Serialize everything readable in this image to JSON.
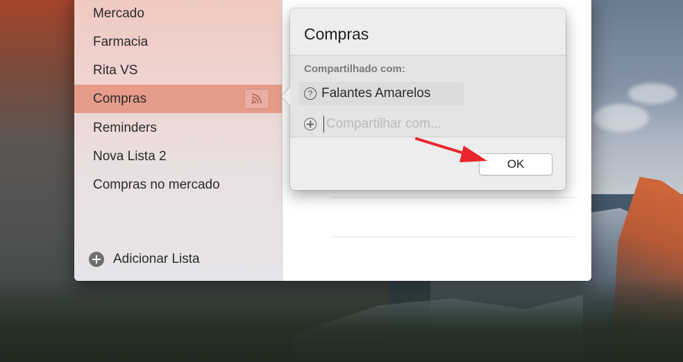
{
  "sidebar": {
    "items": [
      {
        "label": "Mercado"
      },
      {
        "label": "Farmacia"
      },
      {
        "label": "Rita VS"
      },
      {
        "label": "Compras",
        "selected": true,
        "shared_icon": "broadcast-share-icon"
      },
      {
        "label": "Reminders"
      },
      {
        "label": "Nova Lista 2"
      },
      {
        "label": "Compras no mercado"
      }
    ],
    "add_list_label": "Adicionar Lista",
    "add_list_icon": "plus-circle-icon"
  },
  "popover": {
    "title": "Compras",
    "shared_with_label": "Compartilhado com:",
    "participants": [
      {
        "name": "Falantes Amarelos",
        "icon": "question-circle-icon"
      }
    ],
    "share_input_placeholder": "Compartilhar com...",
    "share_input_value": "",
    "ok_label": "OK"
  },
  "annotation": {
    "arrow_color": "#e8262b"
  },
  "colors": {
    "selected_row": "#e79c8a",
    "popover_bg": "#ededed"
  }
}
